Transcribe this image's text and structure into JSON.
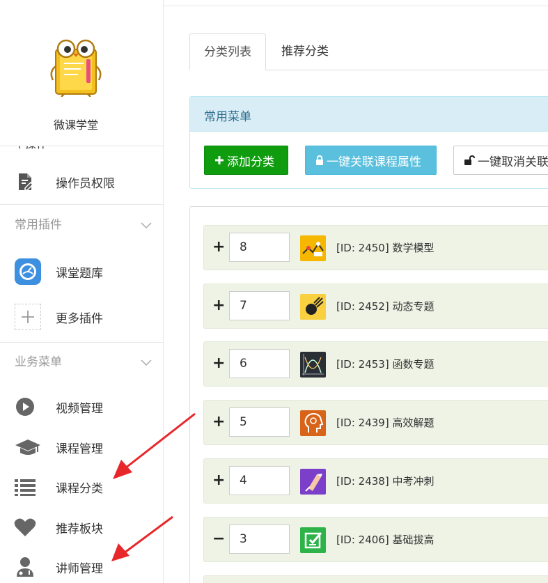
{
  "sidebar": {
    "logo_name": "微课学堂",
    "cut_off_item": "个操作",
    "top_items": [
      {
        "label": "操作员权限",
        "icon": "document-edit-icon"
      }
    ],
    "groups": [
      {
        "title": "常用插件",
        "items": [
          {
            "label": "课堂题库",
            "icon": "question-bank-icon"
          },
          {
            "label": "更多插件",
            "icon": "plus-icon"
          }
        ]
      },
      {
        "title": "业务菜单",
        "items": [
          {
            "label": "视频管理",
            "icon": "play-icon"
          },
          {
            "label": "课程管理",
            "icon": "graduation-cap-icon"
          },
          {
            "label": "课程分类",
            "icon": "list-icon"
          },
          {
            "label": "推荐板块",
            "icon": "heart-icon"
          },
          {
            "label": "讲师管理",
            "icon": "teacher-icon"
          }
        ]
      }
    ]
  },
  "tabs": [
    {
      "label": "分类列表",
      "active": true
    },
    {
      "label": "推荐分类",
      "active": false
    }
  ],
  "panel": {
    "title": "常用菜单",
    "buttons": {
      "add": "添加分类",
      "link": "一键关联课程属性",
      "unlink": "一键取消关联"
    }
  },
  "categories": [
    {
      "toggle": "+",
      "sort": "8",
      "title": "[ID: 2450] 数学模型",
      "thumb_color": "#f5b700"
    },
    {
      "toggle": "+",
      "sort": "7",
      "title": "[ID: 2452] 动态专题",
      "thumb_color": "#f8d040"
    },
    {
      "toggle": "+",
      "sort": "6",
      "title": "[ID: 2453] 函数专题",
      "thumb_color": "#2a2f36"
    },
    {
      "toggle": "+",
      "sort": "5",
      "title": "[ID: 2439] 高效解题",
      "thumb_color": "#d8641a"
    },
    {
      "toggle": "+",
      "sort": "4",
      "title": "[ID: 2438] 中考冲刺",
      "thumb_color": "#7b3fc9"
    },
    {
      "toggle": "−",
      "sort": "3",
      "title": "[ID: 2406] 基础拔高",
      "thumb_color": "#2eb34a"
    }
  ],
  "colors": {
    "arrow": "#e8272a",
    "add_button": "#0f9d0f",
    "link_button": "#5bc0de"
  }
}
